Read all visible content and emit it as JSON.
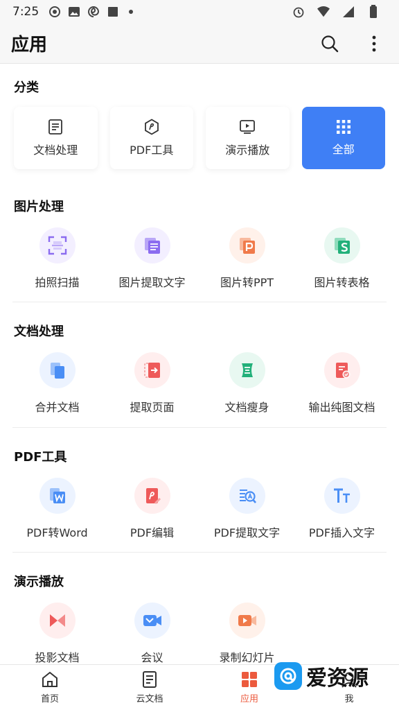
{
  "status_bar": {
    "time": "7:25"
  },
  "app_bar": {
    "title": "应用"
  },
  "categories": {
    "title": "分类",
    "items": [
      {
        "label": "文档处理",
        "icon": "document-icon"
      },
      {
        "label": "PDF工具",
        "icon": "pdf-tool-icon"
      },
      {
        "label": "演示播放",
        "icon": "presentation-icon"
      },
      {
        "label": "全部",
        "icon": "grid-icon",
        "active": true
      }
    ],
    "accent": "#3f7ff5"
  },
  "sections": [
    {
      "title": "图片处理",
      "tools": [
        {
          "label": "拍照扫描",
          "icon": "scan-icon",
          "color": "#8b6cf0",
          "bg": "#f3efff"
        },
        {
          "label": "图片提取文字",
          "icon": "image-text-icon",
          "color": "#8b6cf0",
          "bg": "#f3efff"
        },
        {
          "label": "图片转PPT",
          "icon": "image-ppt-icon",
          "color": "#f07a4a",
          "bg": "#fff1ea"
        },
        {
          "label": "图片转表格",
          "icon": "image-sheet-icon",
          "color": "#22b07a",
          "bg": "#e8f8f1"
        }
      ]
    },
    {
      "title": "文档处理",
      "tools": [
        {
          "label": "合并文档",
          "icon": "merge-icon",
          "color": "#4a8ef5",
          "bg": "#ecf3ff"
        },
        {
          "label": "提取页面",
          "icon": "extract-page-icon",
          "color": "#ee5a5a",
          "bg": "#ffeeee"
        },
        {
          "label": "文档瘦身",
          "icon": "slim-icon",
          "color": "#22b07a",
          "bg": "#e8f8f1"
        },
        {
          "label": "输出纯图文档",
          "icon": "image-doc-icon",
          "color": "#ee5a5a",
          "bg": "#ffeeee"
        }
      ]
    },
    {
      "title": "PDF工具",
      "tools": [
        {
          "label": "PDF转Word",
          "icon": "pdf-word-icon",
          "color": "#4a8ef5",
          "bg": "#ecf3ff"
        },
        {
          "label": "PDF编辑",
          "icon": "pdf-edit-icon",
          "color": "#ee5a5a",
          "bg": "#ffeeee"
        },
        {
          "label": "PDF提取文字",
          "icon": "pdf-text-icon",
          "color": "#4a8ef5",
          "bg": "#ecf3ff"
        },
        {
          "label": "PDF插入文字",
          "icon": "insert-text-icon",
          "color": "#4a8ef5",
          "bg": "#ecf3ff"
        }
      ]
    },
    {
      "title": "演示播放",
      "tools": [
        {
          "label": "投影文档",
          "icon": "projection-icon",
          "color": "#ee5a5a",
          "bg": "#ffeeee"
        },
        {
          "label": "会议",
          "icon": "meeting-icon",
          "color": "#4a8ef5",
          "bg": "#ecf3ff"
        },
        {
          "label": "录制幻灯片",
          "icon": "record-icon",
          "color": "#f07a4a",
          "bg": "#fff1ea"
        }
      ]
    }
  ],
  "bottom_nav": {
    "items": [
      {
        "label": "首页",
        "icon": "home-icon"
      },
      {
        "label": "云文档",
        "icon": "cloud-doc-icon"
      },
      {
        "label": "应用",
        "icon": "apps-icon",
        "active": true
      },
      {
        "label": "我",
        "icon": "me-icon"
      }
    ],
    "active_color": "#ec5a3d"
  },
  "watermark": {
    "text": "爱资源"
  }
}
